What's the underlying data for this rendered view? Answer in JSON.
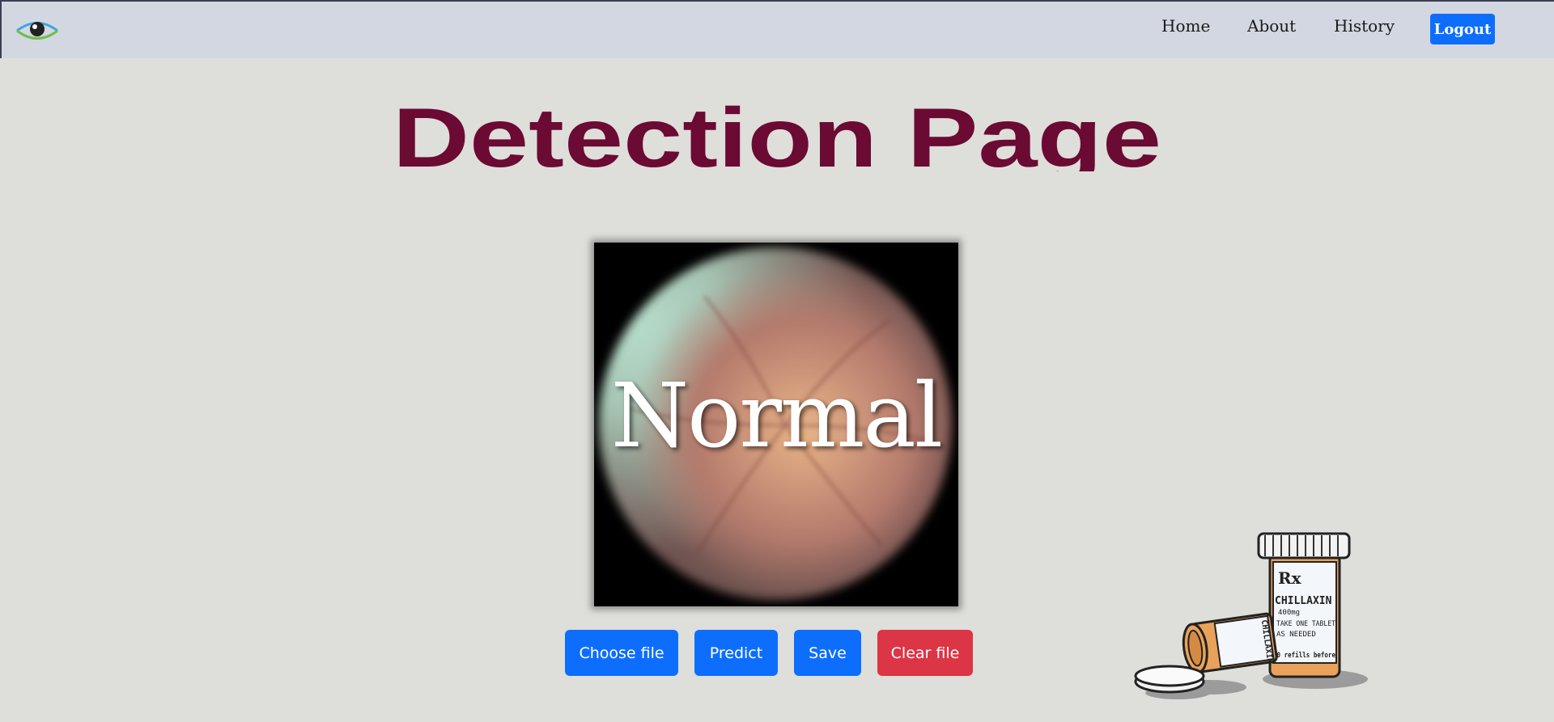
{
  "nav": {
    "links": [
      "Home",
      "About",
      "History"
    ],
    "logout_label": "Logout"
  },
  "page": {
    "title": "Detection Page"
  },
  "result": {
    "label": "Normal"
  },
  "actions": {
    "choose_file": "Choose file",
    "predict": "Predict",
    "save": "Save",
    "clear_file": "Clear file"
  },
  "illustration": {
    "bottle_lines": [
      "CHILLAXIN",
      "400mg",
      "TAKE ONE TABLET",
      "AS NEEDED",
      "50 refills before"
    ],
    "rx_mark": "Rx",
    "side_label": "CHILLAXIN"
  },
  "colors": {
    "title": "#6b0a33",
    "primary": "#0d6efd",
    "danger": "#dc3545",
    "navbar": "#d3d7e1",
    "background": "#dededa"
  }
}
